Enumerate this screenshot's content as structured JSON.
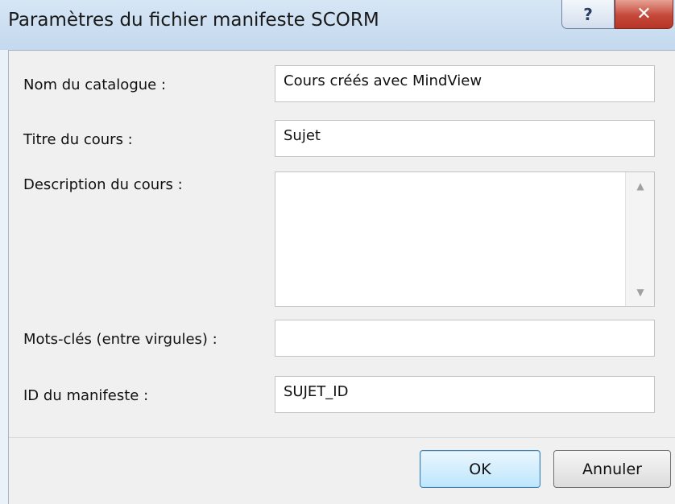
{
  "window": {
    "title": "Paramètres du fichier manifeste SCORM",
    "help_icon": "help-icon",
    "close_icon": "close-icon",
    "help_glyph": "?",
    "close_glyph": "✕"
  },
  "form": {
    "catalog_label": "Nom du catalogue :",
    "catalog_value": "Cours créés avec MindView",
    "course_title_label": "Titre du cours :",
    "course_title_value": "Sujet",
    "description_label": "Description du cours :",
    "description_value": "",
    "keywords_label": "Mots-clés (entre virgules) :",
    "keywords_value": "",
    "manifest_id_label": "ID du manifeste :",
    "manifest_id_value": "SUJET_ID"
  },
  "buttons": {
    "ok_label": "OK",
    "cancel_label": "Annuler"
  },
  "colors": {
    "titlebar": "#c4d9ee",
    "close_button": "#c5483a",
    "panel": "#f0f0f0",
    "ok_button_border": "#3c7fb1"
  }
}
